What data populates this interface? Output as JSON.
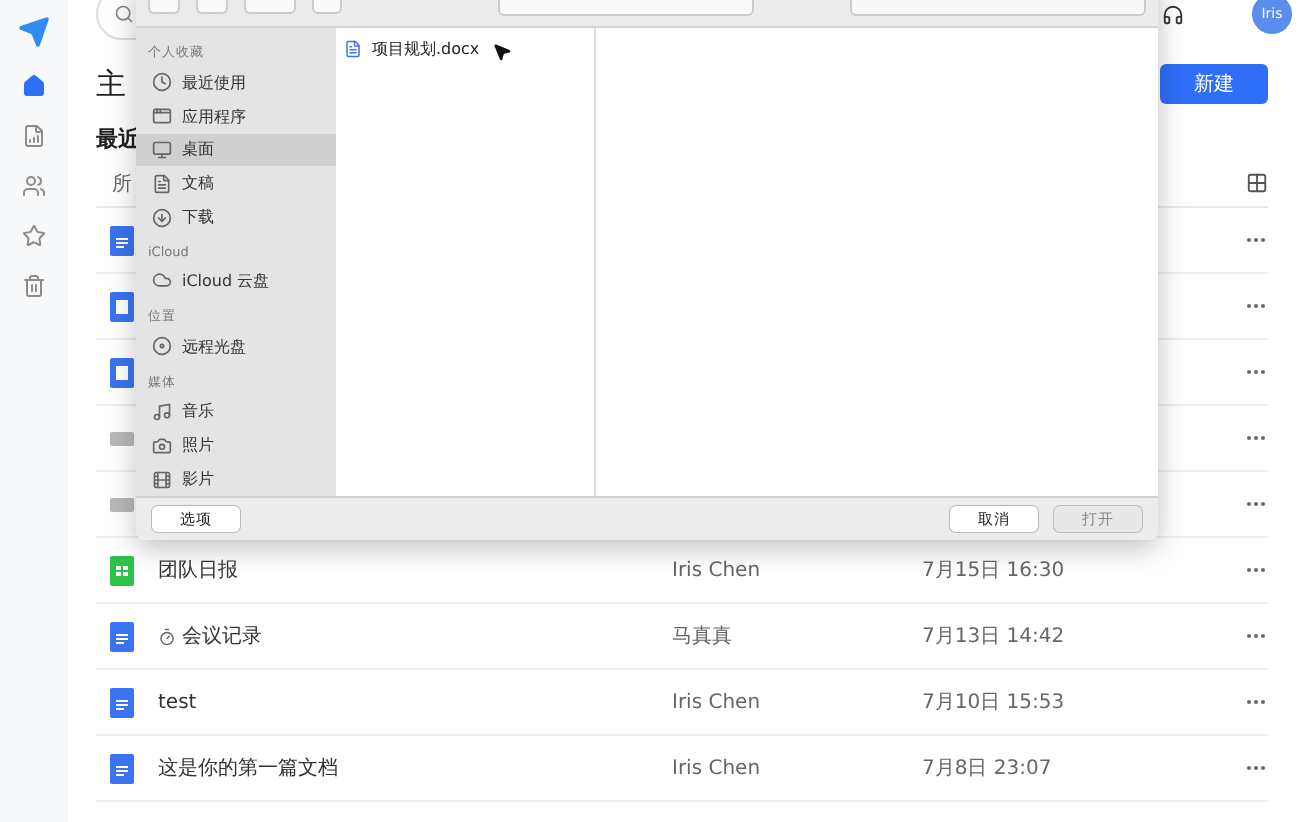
{
  "header": {
    "avatar": "Iris"
  },
  "rail": [
    {
      "kind": "home",
      "selected": true
    },
    {
      "kind": "report",
      "selected": false
    },
    {
      "kind": "people",
      "selected": false
    },
    {
      "kind": "star",
      "selected": false
    },
    {
      "kind": "trash",
      "selected": false
    }
  ],
  "page_title": "主",
  "new_button": "新建",
  "section_title": "最近",
  "filter_label": "所",
  "rows": [
    {
      "kind": "doc",
      "timer": false
    },
    {
      "kind": "slide",
      "timer": false
    },
    {
      "kind": "slide",
      "timer": false
    },
    {
      "kind": "folder",
      "timer": false
    },
    {
      "kind": "folder",
      "timer": false
    },
    {
      "kind": "sheet",
      "timer": false,
      "name": "团队日报",
      "owner": "Iris Chen",
      "time": "7月15日 16:30"
    },
    {
      "kind": "doc",
      "timer": true,
      "name": "会议记录",
      "owner": "马真真",
      "time": "7月13日 14:42"
    },
    {
      "kind": "doc",
      "timer": false,
      "name": "test",
      "owner": "Iris Chen",
      "time": "7月10日 15:53"
    },
    {
      "kind": "doc",
      "timer": false,
      "name": "这是你的第一篇文档",
      "owner": "Iris Chen",
      "time": "7月8日 23:07"
    }
  ],
  "dialog": {
    "sections": [
      {
        "title": "个人收藏",
        "items": [
          {
            "label": "最近使用",
            "kind": "recent",
            "selected": false
          },
          {
            "label": "应用程序",
            "kind": "apps",
            "selected": false
          },
          {
            "label": "桌面",
            "kind": "desktop",
            "selected": true
          },
          {
            "label": "文稿",
            "kind": "docs",
            "selected": false
          },
          {
            "label": "下载",
            "kind": "download",
            "selected": false
          }
        ]
      },
      {
        "title": "iCloud",
        "items": [
          {
            "label": "iCloud 云盘",
            "kind": "cloud",
            "selected": false
          }
        ]
      },
      {
        "title": "位置",
        "items": [
          {
            "label": "远程光盘",
            "kind": "disc",
            "selected": false
          }
        ]
      },
      {
        "title": "媒体",
        "items": [
          {
            "label": "音乐",
            "kind": "music",
            "selected": false
          },
          {
            "label": "照片",
            "kind": "photo",
            "selected": false
          },
          {
            "label": "影片",
            "kind": "movie",
            "selected": false
          }
        ]
      }
    ],
    "files": [
      {
        "name": "项目规划.docx"
      }
    ],
    "options_button": "选项",
    "cancel_button": "取消",
    "open_button": {
      "label": "打开",
      "disabled": true
    }
  }
}
